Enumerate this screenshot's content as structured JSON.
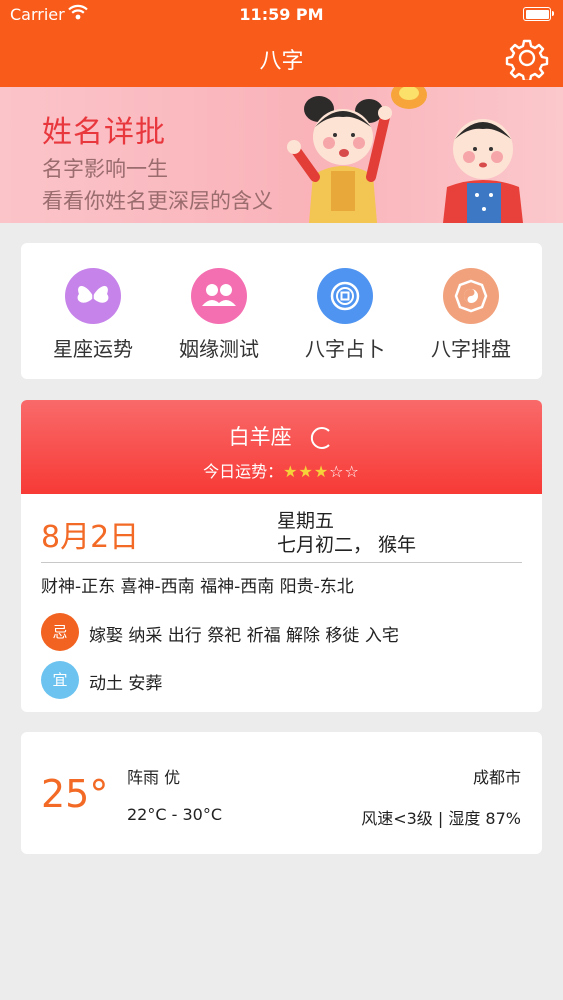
{
  "status_bar": {
    "carrier": "Carrier",
    "time": "11:59 PM"
  },
  "nav": {
    "title": "八字",
    "settings_icon": "gear-icon"
  },
  "banner": {
    "title": "姓名详批",
    "line1": "名字影响一生",
    "line2": "看看你姓名更深层的含义"
  },
  "menu": {
    "items": [
      {
        "label": "星座运势",
        "icon": "butterfly-icon",
        "color": "#c684ea"
      },
      {
        "label": "姻缘测试",
        "icon": "couple-icon",
        "color": "#f46fb1"
      },
      {
        "label": "八字占卜",
        "icon": "coin-icon",
        "color": "#4f94f0"
      },
      {
        "label": "八字排盘",
        "icon": "bagua-icon",
        "color": "#f1a27d"
      }
    ]
  },
  "fortune": {
    "sign": "白羊座",
    "luck_label": "今日运势：",
    "luck_stars_filled": "★★★",
    "luck_stars_empty": "☆☆",
    "date": "8月2日",
    "weekday": "星期五",
    "lunar": "七月初二， 猴年",
    "gods": "财神-正东 喜神-西南 福神-西南 阳贵-东北",
    "ji_badge": "忌",
    "ji_text": "嫁娶 纳采 出行 祭祀 祈福 解除 移徙 入宅",
    "yi_badge": "宜",
    "yi_text": "动土 安葬"
  },
  "weather": {
    "temp": "25°",
    "condition": "阵雨 优",
    "range": "22°C - 30°C",
    "city": "成都市",
    "wind_humidity": "风速<3级 | 湿度 87%"
  },
  "colors": {
    "accent": "#f95b1a",
    "banner_bg": "#f9b8be",
    "fortune_head": "#f73a36"
  }
}
